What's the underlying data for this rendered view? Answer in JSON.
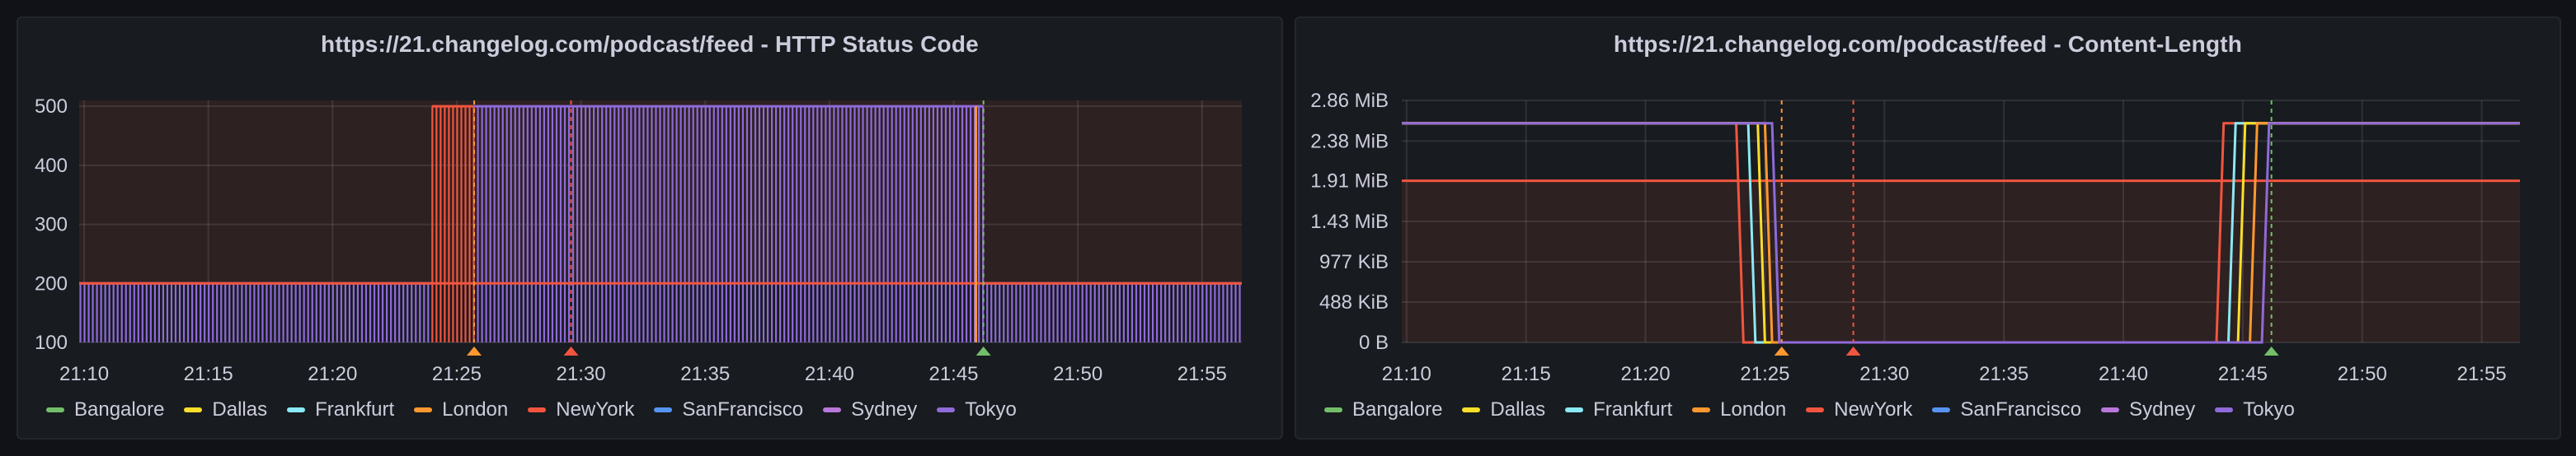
{
  "colors": {
    "Bangalore": "#73bf69",
    "Dallas": "#fade2a",
    "Frankfurt": "#8ae9f5",
    "London": "#ff9830",
    "NewYork": "#f2553f",
    "SanFrancisco": "#5794f2",
    "Sydney": "#b877d9",
    "Tokyo": "#8f6ad9"
  },
  "legend": [
    "Bangalore",
    "Dallas",
    "Frankfurt",
    "London",
    "NewYork",
    "SanFrancisco",
    "Sydney",
    "Tokyo"
  ],
  "chart_data": [
    {
      "type": "line",
      "title": "https://21.changelog.com/podcast/feed - HTTP Status Code",
      "xlabel": "",
      "ylabel": "",
      "x_ticks": [
        "21:10",
        "21:15",
        "21:20",
        "21:25",
        "21:30",
        "21:35",
        "21:40",
        "21:45",
        "21:50",
        "21:55"
      ],
      "x_range": [
        "21:09.8",
        "21:56.6"
      ],
      "y_ticks": [
        "100",
        "200",
        "300",
        "400",
        "500"
      ],
      "ylim": [
        100,
        510
      ],
      "threshold": 200,
      "grid": true,
      "legend_position": "bottom-left",
      "series": [
        {
          "name": "Tokyo",
          "values_summary": "status 200 from 21:10 to 21:25.7, 500 from 21:25.7 to 21:46.2, 200 from 21:46.2 to 21:56.6 (sampled every ~10s, each check drawn as a thin bar)"
        },
        {
          "name": "NewYork",
          "values_summary": "500 from 21:24.0 to 21:25.7, then 200"
        },
        {
          "name": "London",
          "values_summary": "500 until 21:45.9, then 200"
        }
      ],
      "annotations": [
        {
          "time": "21:25.7",
          "color": "#ff9830"
        },
        {
          "time": "21:29.6",
          "color": "#f2553f"
        },
        {
          "time": "21:46.2",
          "color": "#73bf69"
        }
      ]
    },
    {
      "type": "line",
      "title": "https://21.changelog.com/podcast/feed - Content-Length",
      "xlabel": "",
      "ylabel": "",
      "x_ticks": [
        "21:10",
        "21:15",
        "21:20",
        "21:25",
        "21:30",
        "21:35",
        "21:40",
        "21:45",
        "21:50",
        "21:55"
      ],
      "x_range": [
        "21:09.8",
        "21:56.6"
      ],
      "y_ticks": [
        "0 B",
        "488 KiB",
        "977 KiB",
        "1.43 MiB",
        "1.91 MiB",
        "2.38 MiB",
        "2.86 MiB"
      ],
      "ylim_mib": [
        0,
        2.86
      ],
      "threshold_mib": 1.91,
      "grid": true,
      "legend_position": "bottom-left",
      "series": [
        {
          "name": "NewYork",
          "x": [
            "21:09.8",
            "21:23.8",
            "21:24.1",
            "21:43.9",
            "21:44.2",
            "21:56.6"
          ],
          "y_mib": [
            2.59,
            2.59,
            0,
            0,
            2.59,
            2.59
          ]
        },
        {
          "name": "Frankfurt",
          "x": [
            "21:09.8",
            "21:24.3",
            "21:24.6",
            "21:44.4",
            "21:44.7",
            "21:56.6"
          ],
          "y_mib": [
            2.59,
            2.59,
            0,
            0,
            2.59,
            2.59
          ]
        },
        {
          "name": "Dallas",
          "x": [
            "21:09.8",
            "21:24.7",
            "21:25.0",
            "21:44.8",
            "21:45.1",
            "21:56.6"
          ],
          "y_mib": [
            2.59,
            2.59,
            0,
            0,
            2.59,
            2.59
          ]
        },
        {
          "name": "London",
          "x": [
            "21:09.8",
            "21:25.0",
            "21:25.3",
            "21:45.3",
            "21:45.6",
            "21:56.6"
          ],
          "y_mib": [
            2.59,
            2.59,
            0,
            0,
            2.59,
            2.59
          ]
        },
        {
          "name": "Tokyo",
          "x": [
            "21:09.8",
            "21:25.3",
            "21:25.6",
            "21:45.8",
            "21:46.1",
            "21:56.6"
          ],
          "y_mib": [
            2.59,
            2.59,
            0,
            0,
            2.59,
            2.59
          ]
        }
      ],
      "annotations": [
        {
          "time": "21:25.7",
          "color": "#ff9830"
        },
        {
          "time": "21:28.7",
          "color": "#f2553f"
        },
        {
          "time": "21:46.2",
          "color": "#73bf69"
        }
      ]
    }
  ]
}
